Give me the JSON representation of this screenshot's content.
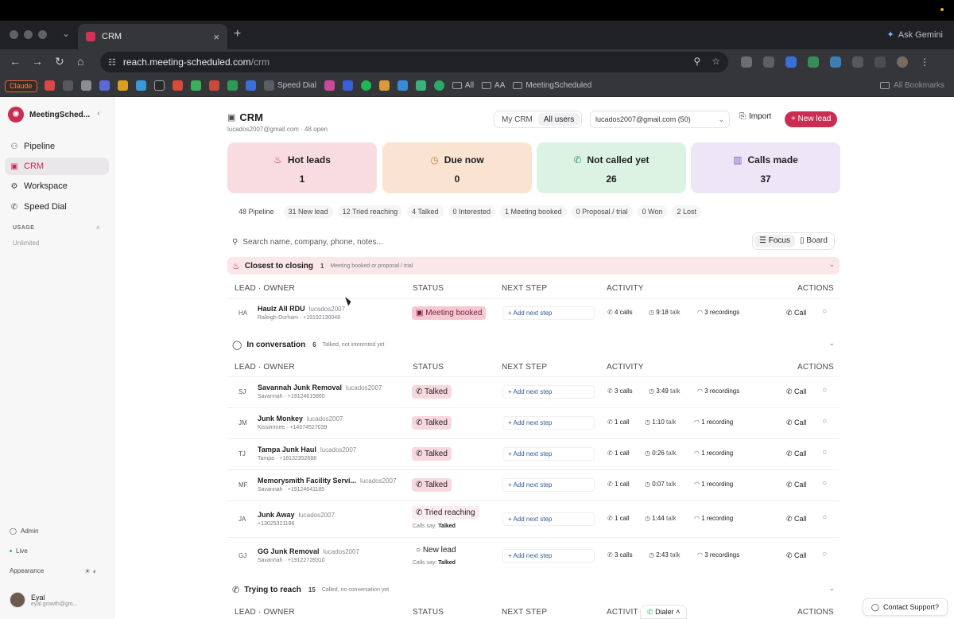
{
  "browser": {
    "tab_title": "CRM",
    "gemini_label": "Ask Gemini",
    "url_host": "reach.meeting-scheduled.com",
    "url_path": "/crm",
    "bookmark_claude": "Claude",
    "bookmark_speed_dial": "Speed Dial",
    "bookmark_all": "All",
    "bookmark_aa": "AA",
    "bookmark_meeting": "MeetingScheduled",
    "all_bookmarks": "All Bookmarks"
  },
  "sidebar": {
    "brand": "MeetingSched...",
    "items": [
      {
        "label": "Pipeline",
        "icon": "pipeline-icon"
      },
      {
        "label": "CRM",
        "icon": "briefcase-icon"
      },
      {
        "label": "Workspace",
        "icon": "gear-icon"
      },
      {
        "label": "Speed Dial",
        "icon": "phone-icon"
      }
    ],
    "usage_heading": "USAGE",
    "usage_value": "Unlimited",
    "admin": "Admin",
    "live": "Live",
    "appearance": "Appearance",
    "user_name": "Eyal",
    "user_email": "eyal.growth@gm..."
  },
  "header": {
    "title": "CRM",
    "subtitle": "lucados2007@gmail.com · 48 open",
    "seg_my": "My CRM",
    "seg_all": "All users",
    "owner_select": "lucados2007@gmail.com (50)",
    "import": "Import",
    "new_lead": "New lead"
  },
  "kpis": [
    {
      "label": "Hot leads",
      "value": "1",
      "bg": "#f9dce2",
      "icon": "flame-icon"
    },
    {
      "label": "Due now",
      "value": "0",
      "bg": "#fbe3d2",
      "icon": "clock-icon"
    },
    {
      "label": "Not called yet",
      "value": "26",
      "bg": "#dcf3e4",
      "icon": "phone-icon"
    },
    {
      "label": "Calls made",
      "value": "37",
      "bg": "#ece6f6",
      "icon": "bar-chart-icon"
    }
  ],
  "pipeline": [
    "48 Pipeline",
    "31 New lead",
    "12 Tried reaching",
    "4 Talked",
    "0 Interested",
    "1 Meeting booked",
    "0 Proposal / trial",
    "0 Won",
    "2 Lost"
  ],
  "search": {
    "placeholder": "Search name, company, phone, notes..."
  },
  "view": {
    "focus": "Focus",
    "board": "Board"
  },
  "columns": {
    "lead": "LEAD · OWNER",
    "status": "STATUS",
    "next": "NEXT STEP",
    "activity": "ACTIVITY",
    "actions": "ACTIONS",
    "activity_cut": "ACTIVIT"
  },
  "groups": [
    {
      "title": "Closest to closing",
      "count": "1",
      "desc": "Meeting booked or proposal / trial"
    },
    {
      "title": "In conversation",
      "count": "6",
      "desc": "Talked, not interested yet"
    },
    {
      "title": "Trying to reach",
      "count": "15",
      "desc": "Called, no conversation yet"
    }
  ],
  "rows_closing": [
    {
      "initials": "HA",
      "name": "Haulz All RDU",
      "owner": "lucados2007",
      "meta": "Raleigh-Durham · +19192130048",
      "status": "Meeting booked",
      "calls": "4 calls",
      "talk": "9:18",
      "recordings": "3 recordings"
    }
  ],
  "rows_conversation": [
    {
      "initials": "SJ",
      "name": "Savannah Junk Removal",
      "owner": "lucados2007",
      "meta": "Savannah · +19124615865",
      "status": "Talked",
      "calls": "3 calls",
      "talk": "3:49",
      "recordings": "3 recordings"
    },
    {
      "initials": "JM",
      "name": "Junk Monkey",
      "owner": "lucados2007",
      "meta": "Kissimmee · +14074527039",
      "status": "Talked",
      "calls": "1 call",
      "talk": "1:10",
      "recordings": "1 recording"
    },
    {
      "initials": "TJ",
      "name": "Tampa Junk Haul",
      "owner": "lucados2007",
      "meta": "Tampa · +18132352688",
      "status": "Talked",
      "calls": "1 call",
      "talk": "0:26",
      "recordings": "1 recording"
    },
    {
      "initials": "MF",
      "name": "Memorysmith Facility Servi...",
      "owner": "lucados2007",
      "meta": "Savannah · +19124641185",
      "status": "Talked",
      "calls": "1 call",
      "talk": "0:07",
      "recordings": "1 recording"
    },
    {
      "initials": "JA",
      "name": "Junk Away",
      "owner": "lucados2007",
      "meta": "+13025321186",
      "status": "Tried reaching",
      "status_sub_prefix": "Calls say:",
      "status_sub": "Talked",
      "calls": "1 call",
      "talk": "1:44",
      "recordings": "1 recording"
    },
    {
      "initials": "GJ",
      "name": "GG Junk Removal",
      "owner": "lucados2007",
      "meta": "Savannah · +19122728310",
      "status": "New lead",
      "status_sub_prefix": "Calls say:",
      "status_sub": "Talked",
      "calls": "3 calls",
      "talk": "2:43",
      "recordings": "3 recordings"
    }
  ],
  "labels": {
    "add_next_step": "+ Add next step",
    "talk": "talk",
    "call": "Call",
    "dialer": "Dialer",
    "contact_support": "Contact Support?"
  }
}
